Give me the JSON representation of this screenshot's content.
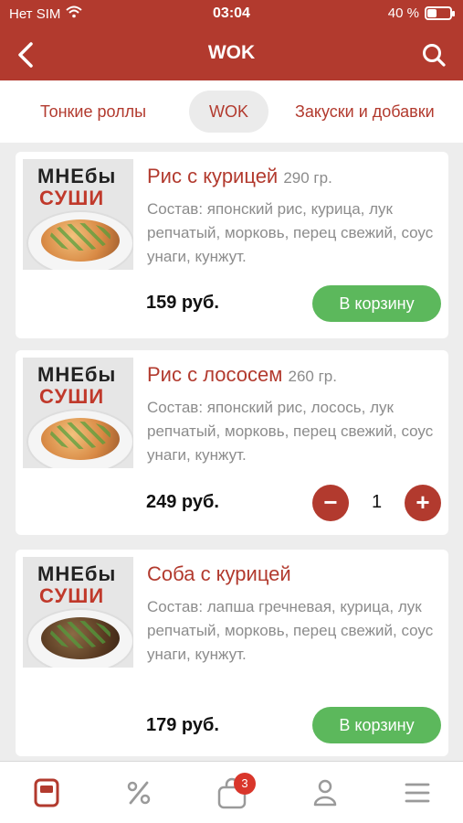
{
  "status": {
    "carrier": "Нет SIM",
    "time": "03:04",
    "battery": "40 %",
    "battery_level": 0.4
  },
  "header": {
    "title": "WOK",
    "back_icon": "back-icon",
    "search_icon": "search-icon"
  },
  "tabs": [
    {
      "label": "Тонкие роллы",
      "active": false
    },
    {
      "label": "WOK",
      "active": true
    },
    {
      "label": "Закуски и добавки",
      "active": false
    }
  ],
  "products": [
    {
      "name": "Рис с курицей",
      "weight": "290 гр.",
      "description": "Состав: японский рис, курица, лук репчатый, морковь, перец свежий, соус унаги, кунжут.",
      "price": "159 руб.",
      "button": "В корзину",
      "logo_line1": "МНЕбы",
      "logo_line2": "СУШИ"
    },
    {
      "name": "Рис с лососем",
      "weight": "260 гр.",
      "description": "Состав: японский рис, лосось, лук репчатый, морковь, перец свежий, соус унаги, кунжут.",
      "price": "249 руб.",
      "quantity": "1",
      "minus": "−",
      "plus": "+",
      "logo_line1": "МНЕбы",
      "logo_line2": "СУШИ"
    },
    {
      "name": "Соба с курицей",
      "weight": "",
      "description": "Состав: лапша гречневая, курица, лук репчатый, морковь, перец свежий, соус унаги, кунжут.",
      "price": "179 руб.",
      "button": "В корзину",
      "logo_line1": "МНЕбы",
      "logo_line2": "СУШИ"
    }
  ],
  "bottom_nav": {
    "items": [
      "menu-icon",
      "percent-icon",
      "cart-icon",
      "profile-icon",
      "hamburger-icon"
    ],
    "cart_badge": "3",
    "accent": "#b23a2e",
    "inactive": "#9a9a9a"
  },
  "colors": {
    "brand": "#b23a2e",
    "cart_button": "#5cb85c"
  }
}
